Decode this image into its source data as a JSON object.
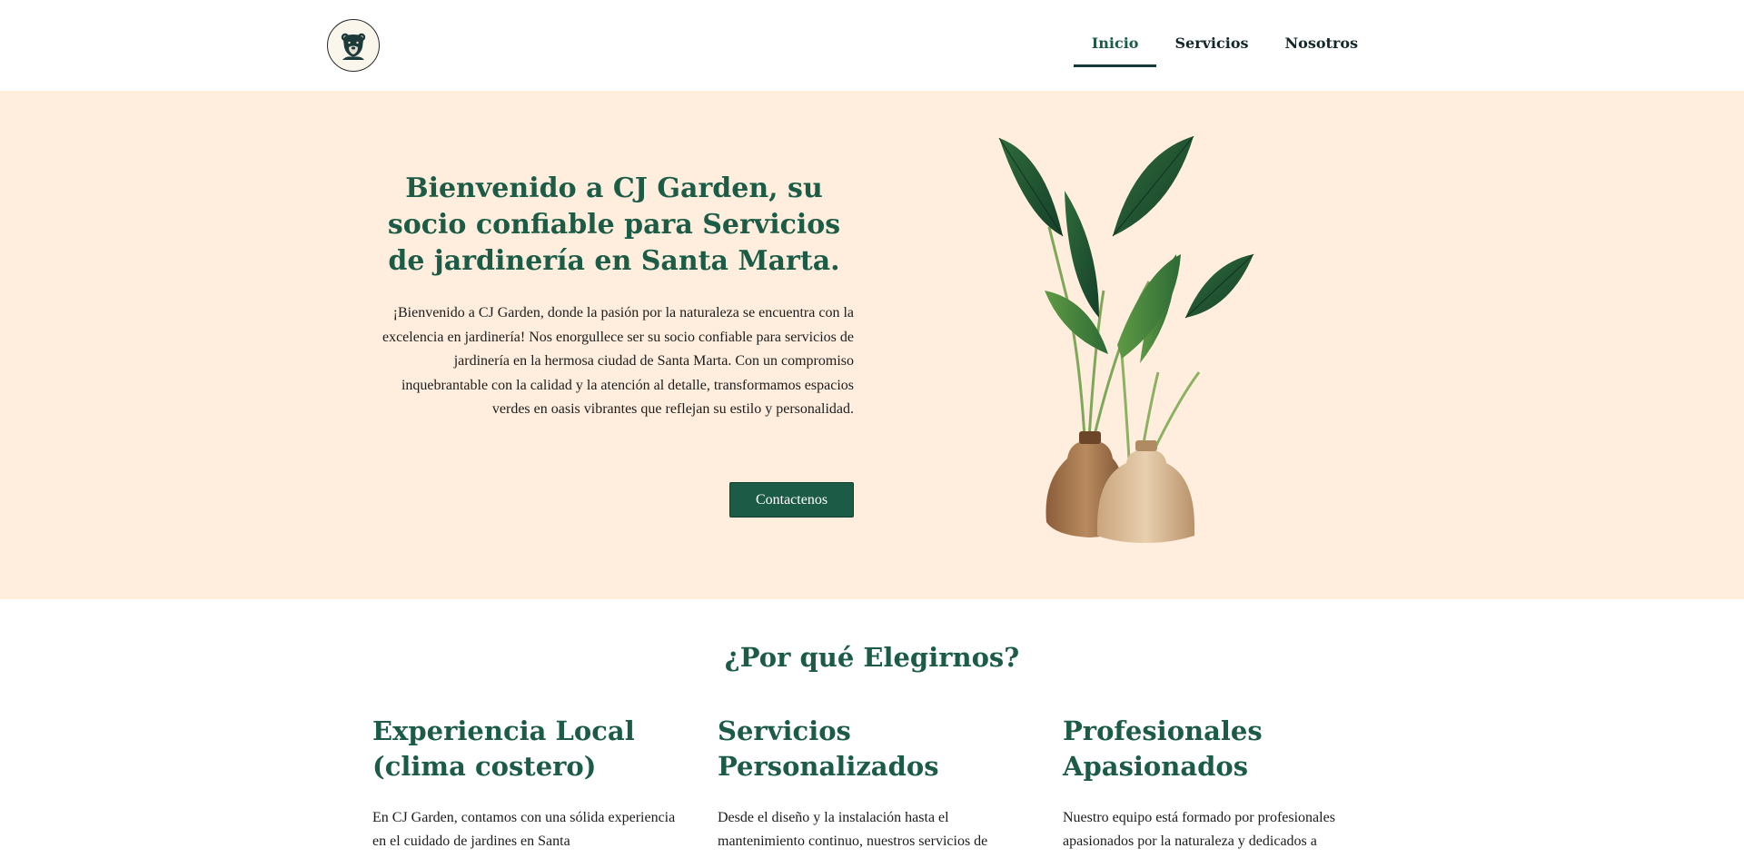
{
  "nav": {
    "items": [
      {
        "label": "Inicio",
        "active": true
      },
      {
        "label": "Servicios",
        "active": false
      },
      {
        "label": "Nosotros",
        "active": false
      }
    ]
  },
  "hero": {
    "title": "Bienvenido a CJ Garden, su socio confiable para Servicios de jardinería en Santa Marta.",
    "body": "¡Bienvenido a CJ Garden, donde la pasión por la naturaleza se encuentra con la excelencia en jardinería! Nos enorgullece ser su socio confiable para servicios de jardinería en la hermosa ciudad de Santa Marta. Con un compromiso inquebrantable con la calidad y la atención al detalle, transformamos espacios verdes en oasis vibrantes que reflejan su estilo y personalidad.",
    "button_label": "Contactenos"
  },
  "why": {
    "title": "¿Por qué Elegirnos?",
    "columns": [
      {
        "heading": "Experiencia Local (clima costero)",
        "text": "En CJ Garden, contamos con una sólida experiencia en el cuidado de jardines en Santa"
      },
      {
        "heading": "Servicios Personalizados",
        "text": "Desde el diseño y la instalación hasta el mantenimiento continuo, nuestros servicios de"
      },
      {
        "heading": "Profesionales Apasionados",
        "text": "Nuestro equipo está formado por profesionales apasionados por la naturaleza y dedicados a"
      }
    ]
  },
  "colors": {
    "brand_green": "#1c5c46",
    "hero_background": "#ffeedd",
    "nav_text": "#14282b"
  },
  "icons": {
    "logo": "bear-logo-icon",
    "hero_image": "potted-plants-image"
  }
}
